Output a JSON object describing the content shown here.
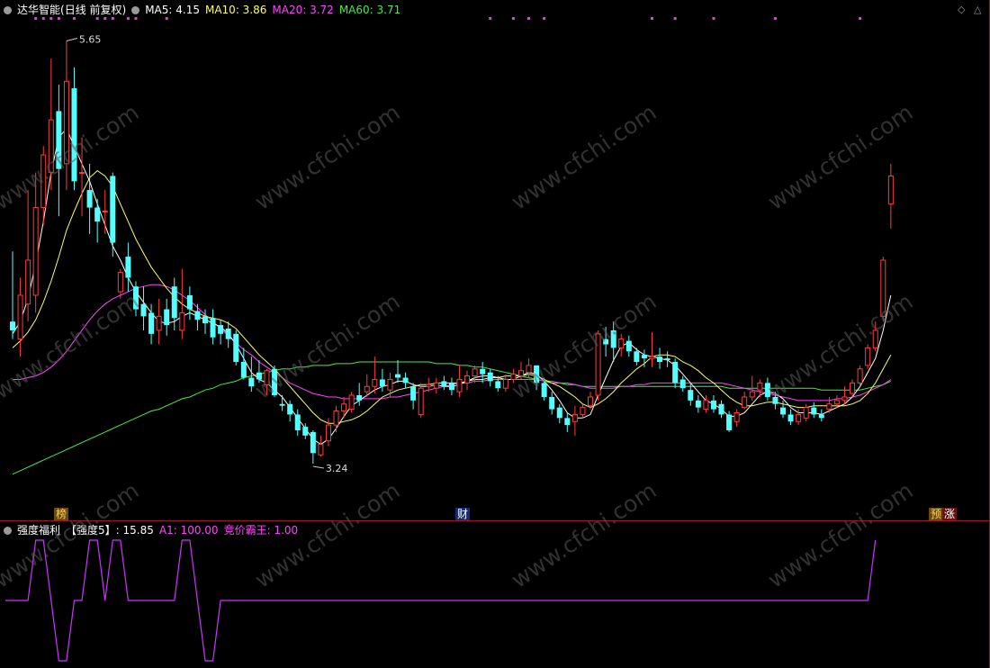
{
  "header": {
    "stock_name": "达华智能",
    "period": "(日线 前复权)",
    "ma_items": [
      {
        "label": "MA5: 4.15",
        "color": "#ffffff"
      },
      {
        "label": "MA10: 3.86",
        "color": "#ffff66"
      },
      {
        "label": "MA20: 3.72",
        "color": "#ff44ff"
      },
      {
        "label": "MA60: 3.71",
        "color": "#44ee44"
      }
    ]
  },
  "indicator_header": {
    "name": "强度福利",
    "items": [
      {
        "label": "【强度5】: 15.85",
        "color": "#ffffff"
      },
      {
        "label": "A1: 100.00",
        "color": "#ff44ff"
      },
      {
        "label": "竞价霸王: 1.00",
        "color": "#ff44ff"
      }
    ]
  },
  "markers": {
    "bang": "榜",
    "cai": "财",
    "yu": "预",
    "zhang": "涨"
  },
  "watermark": "www.cfchi.com",
  "colors": {
    "up": "#ff3c3c",
    "down": "#54ffff",
    "ma5": "#ffffff",
    "ma10": "#ffff66",
    "ma20": "#ff44ff",
    "ma60": "#44ee44",
    "ind": "#cc33ff"
  },
  "chart_data": {
    "type": "candlestick",
    "ylim": [
      3.05,
      5.75
    ],
    "high_label": "5.65",
    "low_label": "3.24",
    "candles": [
      [
        4.05,
        4.0,
        4.45,
        3.95
      ],
      [
        3.95,
        4.2,
        4.3,
        3.85
      ],
      [
        4.15,
        4.4,
        4.8,
        4.05
      ],
      [
        4.2,
        4.7,
        4.9,
        4.1
      ],
      [
        4.7,
        5.0,
        5.05,
        4.6
      ],
      [
        4.9,
        5.2,
        5.55,
        4.8
      ],
      [
        5.25,
        4.92,
        5.4,
        4.65
      ],
      [
        4.95,
        5.42,
        5.65,
        4.8
      ],
      [
        5.38,
        4.85,
        5.5,
        4.8
      ],
      [
        4.9,
        4.9,
        5.1,
        4.65
      ],
      [
        4.8,
        4.7,
        4.95,
        4.55
      ],
      [
        4.7,
        4.62,
        4.75,
        4.5
      ],
      [
        4.68,
        4.68,
        4.8,
        4.55
      ],
      [
        4.88,
        4.5,
        4.9,
        4.42
      ],
      [
        4.22,
        4.33,
        4.35,
        4.18
      ],
      [
        4.42,
        4.3,
        4.5,
        4.22
      ],
      [
        4.25,
        4.12,
        4.28,
        4.08
      ],
      [
        4.15,
        4.08,
        4.25,
        4.0
      ],
      [
        4.1,
        3.98,
        4.15,
        3.92
      ],
      [
        4.0,
        4.08,
        4.18,
        3.92
      ],
      [
        4.12,
        4.03,
        4.18,
        3.97
      ],
      [
        4.25,
        4.07,
        4.3,
        4.0
      ],
      [
        4.0,
        4.1,
        4.35,
        3.95
      ],
      [
        4.2,
        4.12,
        4.25,
        4.06
      ],
      [
        4.11,
        4.06,
        4.15,
        4.0
      ],
      [
        4.08,
        4.04,
        4.12,
        3.98
      ],
      [
        4.07,
        3.96,
        4.12,
        3.92
      ],
      [
        4.03,
        3.98,
        4.06,
        3.92
      ],
      [
        4.01,
        3.95,
        4.05,
        3.9
      ],
      [
        3.98,
        3.82,
        4.0,
        3.8
      ],
      [
        3.82,
        3.73,
        3.9,
        3.72
      ],
      [
        3.73,
        3.68,
        3.85,
        3.65
      ],
      [
        3.76,
        3.72,
        3.83,
        3.7
      ],
      [
        3.69,
        3.77,
        3.78,
        3.63
      ],
      [
        3.78,
        3.63,
        3.8,
        3.62
      ],
      [
        3.58,
        3.57,
        3.63,
        3.54
      ],
      [
        3.58,
        3.52,
        3.6,
        3.48
      ],
      [
        3.52,
        3.43,
        3.55,
        3.4
      ],
      [
        3.45,
        3.4,
        3.47,
        3.38
      ],
      [
        3.42,
        3.3,
        3.43,
        3.24
      ],
      [
        3.29,
        3.35,
        3.4,
        3.28
      ],
      [
        3.37,
        3.46,
        3.5,
        3.34
      ],
      [
        3.46,
        3.54,
        3.57,
        3.42
      ],
      [
        3.54,
        3.58,
        3.62,
        3.5
      ],
      [
        3.55,
        3.63,
        3.65,
        3.53
      ],
      [
        3.63,
        3.6,
        3.7,
        3.57
      ],
      [
        3.65,
        3.68,
        3.75,
        3.62
      ],
      [
        3.68,
        3.72,
        3.85,
        3.64
      ],
      [
        3.72,
        3.68,
        3.78,
        3.65
      ],
      [
        3.66,
        3.72,
        3.76,
        3.62
      ],
      [
        3.75,
        3.73,
        3.83,
        3.7
      ],
      [
        3.73,
        3.7,
        3.76,
        3.67
      ],
      [
        3.68,
        3.6,
        3.7,
        3.55
      ],
      [
        3.52,
        3.67,
        3.7,
        3.5
      ],
      [
        3.68,
        3.69,
        3.73,
        3.65
      ],
      [
        3.67,
        3.7,
        3.73,
        3.64
      ],
      [
        3.71,
        3.68,
        3.74,
        3.66
      ],
      [
        3.7,
        3.66,
        3.73,
        3.63
      ],
      [
        3.65,
        3.72,
        3.8,
        3.62
      ],
      [
        3.7,
        3.74,
        3.77,
        3.66
      ],
      [
        3.74,
        3.78,
        3.8,
        3.7
      ],
      [
        3.78,
        3.75,
        3.82,
        3.7
      ],
      [
        3.76,
        3.71,
        3.78,
        3.68
      ],
      [
        3.71,
        3.67,
        3.74,
        3.65
      ],
      [
        3.67,
        3.72,
        3.75,
        3.65
      ],
      [
        3.72,
        3.75,
        3.78,
        3.7
      ],
      [
        3.74,
        3.77,
        3.82,
        3.72
      ],
      [
        3.76,
        3.8,
        3.84,
        3.73
      ],
      [
        3.8,
        3.7,
        3.8,
        3.66
      ],
      [
        3.7,
        3.62,
        3.73,
        3.6
      ],
      [
        3.62,
        3.55,
        3.65,
        3.52
      ],
      [
        3.56,
        3.5,
        3.58,
        3.47
      ],
      [
        3.5,
        3.46,
        3.53,
        3.42
      ],
      [
        3.48,
        3.52,
        3.57,
        3.4
      ],
      [
        3.52,
        3.56,
        3.58,
        3.5
      ],
      [
        3.57,
        3.62,
        3.65,
        3.55
      ],
      [
        3.63,
        3.98,
        4.0,
        3.6
      ],
      [
        3.95,
        3.92,
        4.02,
        3.85
      ],
      [
        4.0,
        3.9,
        4.05,
        3.82
      ],
      [
        3.9,
        3.95,
        3.98,
        3.85
      ],
      [
        3.94,
        3.88,
        3.97,
        3.85
      ],
      [
        3.88,
        3.82,
        3.9,
        3.8
      ],
      [
        3.86,
        3.84,
        3.89,
        3.79
      ],
      [
        3.84,
        3.85,
        3.99,
        3.79
      ],
      [
        3.85,
        3.82,
        3.9,
        3.78
      ],
      [
        3.84,
        3.83,
        3.88,
        3.79
      ],
      [
        3.82,
        3.7,
        3.84,
        3.67
      ],
      [
        3.72,
        3.67,
        3.74,
        3.65
      ],
      [
        3.66,
        3.6,
        3.7,
        3.57
      ],
      [
        3.6,
        3.56,
        3.63,
        3.53
      ],
      [
        3.55,
        3.6,
        3.63,
        3.53
      ],
      [
        3.6,
        3.55,
        3.63,
        3.53
      ],
      [
        3.58,
        3.52,
        3.6,
        3.5
      ],
      [
        3.52,
        3.43,
        3.54,
        3.42
      ],
      [
        3.48,
        3.53,
        3.55,
        3.45
      ],
      [
        3.56,
        3.62,
        3.65,
        3.55
      ],
      [
        3.62,
        3.65,
        3.74,
        3.6
      ],
      [
        3.66,
        3.7,
        3.72,
        3.62
      ],
      [
        3.7,
        3.62,
        3.73,
        3.6
      ],
      [
        3.62,
        3.58,
        3.65,
        3.55
      ],
      [
        3.56,
        3.52,
        3.6,
        3.5
      ],
      [
        3.52,
        3.48,
        3.55,
        3.46
      ],
      [
        3.48,
        3.52,
        3.55,
        3.46
      ],
      [
        3.5,
        3.56,
        3.58,
        3.48
      ],
      [
        3.56,
        3.52,
        3.59,
        3.5
      ],
      [
        3.52,
        3.5,
        3.55,
        3.48
      ],
      [
        3.55,
        3.58,
        3.62,
        3.53
      ],
      [
        3.58,
        3.6,
        3.63,
        3.56
      ],
      [
        3.6,
        3.62,
        3.68,
        3.58
      ],
      [
        3.64,
        3.7,
        3.72,
        3.62
      ],
      [
        3.7,
        3.78,
        3.8,
        3.68
      ],
      [
        3.8,
        3.9,
        3.92,
        3.78
      ],
      [
        3.9,
        4.0,
        4.05,
        3.88
      ],
      [
        4.08,
        4.4,
        4.42,
        4.05
      ],
      [
        4.72,
        4.88,
        4.95,
        4.58
      ]
    ],
    "ma5": [
      3.98,
      4.05,
      4.18,
      4.38,
      4.62,
      4.9,
      5.1,
      5.15,
      5.05,
      4.95,
      4.85,
      4.72,
      4.6,
      4.48,
      4.4,
      4.3,
      4.22,
      4.16,
      4.1,
      4.05,
      4.04,
      4.05,
      4.08,
      4.1,
      4.08,
      4.06,
      4.04,
      4.02,
      3.98,
      3.92,
      3.84,
      3.76,
      3.72,
      3.7,
      3.66,
      3.62,
      3.56,
      3.5,
      3.44,
      3.38,
      3.35,
      3.38,
      3.44,
      3.51,
      3.57,
      3.6,
      3.63,
      3.66,
      3.68,
      3.69,
      3.71,
      3.71,
      3.69,
      3.68,
      3.68,
      3.69,
      3.68,
      3.68,
      3.69,
      3.71,
      3.73,
      3.74,
      3.74,
      3.73,
      3.72,
      3.72,
      3.74,
      3.76,
      3.75,
      3.71,
      3.66,
      3.6,
      3.53,
      3.5,
      3.5,
      3.52,
      3.63,
      3.73,
      3.83,
      3.91,
      3.93,
      3.89,
      3.86,
      3.85,
      3.84,
      3.83,
      3.8,
      3.75,
      3.7,
      3.65,
      3.6,
      3.58,
      3.55,
      3.51,
      3.51,
      3.53,
      3.58,
      3.63,
      3.65,
      3.64,
      3.61,
      3.56,
      3.53,
      3.53,
      3.53,
      3.52,
      3.54,
      3.56,
      3.58,
      3.62,
      3.68,
      3.76,
      3.84,
      4.0,
      4.2
    ],
    "ma10": [
      3.9,
      3.94,
      3.99,
      4.06,
      4.16,
      4.28,
      4.42,
      4.57,
      4.68,
      4.78,
      4.87,
      4.91,
      4.88,
      4.82,
      4.72,
      4.62,
      4.52,
      4.44,
      4.36,
      4.3,
      4.24,
      4.19,
      4.15,
      4.12,
      4.1,
      4.08,
      4.07,
      4.06,
      4.04,
      4.01,
      3.96,
      3.91,
      3.86,
      3.82,
      3.78,
      3.73,
      3.68,
      3.63,
      3.58,
      3.53,
      3.49,
      3.47,
      3.47,
      3.48,
      3.49,
      3.51,
      3.54,
      3.58,
      3.62,
      3.64,
      3.66,
      3.67,
      3.68,
      3.69,
      3.69,
      3.7,
      3.7,
      3.7,
      3.7,
      3.71,
      3.72,
      3.72,
      3.73,
      3.73,
      3.74,
      3.74,
      3.74,
      3.75,
      3.74,
      3.72,
      3.7,
      3.68,
      3.65,
      3.62,
      3.58,
      3.56,
      3.58,
      3.61,
      3.65,
      3.7,
      3.74,
      3.78,
      3.81,
      3.85,
      3.86,
      3.86,
      3.85,
      3.82,
      3.8,
      3.77,
      3.73,
      3.7,
      3.66,
      3.62,
      3.59,
      3.57,
      3.57,
      3.58,
      3.59,
      3.59,
      3.58,
      3.57,
      3.56,
      3.56,
      3.57,
      3.57,
      3.57,
      3.57,
      3.57,
      3.58,
      3.6,
      3.64,
      3.7,
      3.78,
      3.86
    ],
    "ma20": [
      3.72,
      3.72,
      3.73,
      3.74,
      3.76,
      3.79,
      3.83,
      3.88,
      3.94,
      4.0,
      4.06,
      4.11,
      4.15,
      4.18,
      4.2,
      4.22,
      4.24,
      4.25,
      4.26,
      4.26,
      4.25,
      4.23,
      4.2,
      4.17,
      4.13,
      4.09,
      4.05,
      4.01,
      3.97,
      3.93,
      3.89,
      3.86,
      3.82,
      3.79,
      3.76,
      3.73,
      3.7,
      3.68,
      3.66,
      3.64,
      3.63,
      3.62,
      3.62,
      3.61,
      3.61,
      3.61,
      3.61,
      3.61,
      3.61,
      3.62,
      3.62,
      3.63,
      3.64,
      3.65,
      3.66,
      3.67,
      3.68,
      3.69,
      3.7,
      3.7,
      3.71,
      3.71,
      3.72,
      3.72,
      3.72,
      3.72,
      3.72,
      3.72,
      3.72,
      3.71,
      3.71,
      3.7,
      3.7,
      3.69,
      3.68,
      3.67,
      3.67,
      3.67,
      3.67,
      3.68,
      3.68,
      3.69,
      3.69,
      3.7,
      3.7,
      3.7,
      3.7,
      3.7,
      3.7,
      3.7,
      3.7,
      3.7,
      3.7,
      3.69,
      3.68,
      3.67,
      3.66,
      3.65,
      3.64,
      3.63,
      3.62,
      3.61,
      3.6,
      3.6,
      3.6,
      3.6,
      3.6,
      3.61,
      3.61,
      3.62,
      3.63,
      3.65,
      3.67,
      3.69,
      3.72
    ],
    "ma60": [
      3.18,
      3.2,
      3.22,
      3.24,
      3.26,
      3.28,
      3.3,
      3.32,
      3.34,
      3.36,
      3.38,
      3.4,
      3.42,
      3.44,
      3.46,
      3.48,
      3.5,
      3.52,
      3.54,
      3.55,
      3.57,
      3.59,
      3.61,
      3.62,
      3.64,
      3.66,
      3.67,
      3.69,
      3.7,
      3.71,
      3.73,
      3.74,
      3.75,
      3.76,
      3.77,
      3.78,
      3.78,
      3.79,
      3.79,
      3.8,
      3.8,
      3.8,
      3.81,
      3.81,
      3.81,
      3.82,
      3.82,
      3.82,
      3.82,
      3.82,
      3.82,
      3.82,
      3.82,
      3.82,
      3.82,
      3.81,
      3.81,
      3.81,
      3.8,
      3.8,
      3.79,
      3.79,
      3.78,
      3.77,
      3.76,
      3.75,
      3.74,
      3.73,
      3.72,
      3.71,
      3.7,
      3.7,
      3.69,
      3.69,
      3.68,
      3.68,
      3.68,
      3.68,
      3.68,
      3.68,
      3.68,
      3.68,
      3.68,
      3.68,
      3.68,
      3.68,
      3.68,
      3.68,
      3.68,
      3.68,
      3.68,
      3.68,
      3.68,
      3.67,
      3.67,
      3.67,
      3.67,
      3.67,
      3.67,
      3.67,
      3.67,
      3.67,
      3.67,
      3.67,
      3.67,
      3.66,
      3.66,
      3.66,
      3.66,
      3.66,
      3.66,
      3.67,
      3.68,
      3.69,
      3.71
    ],
    "indicator": [
      0,
      0,
      0,
      100,
      100,
      0,
      -100,
      -100,
      0,
      0,
      100,
      100,
      0,
      100,
      100,
      0,
      0,
      0,
      0,
      0,
      0,
      0,
      100,
      100,
      0,
      -100,
      -100,
      0,
      0,
      0,
      0,
      0,
      0,
      0,
      0,
      0,
      0,
      0,
      0,
      0,
      0,
      0,
      0,
      0,
      0,
      0,
      0,
      0,
      0,
      0,
      0,
      0,
      0,
      0,
      0,
      0,
      0,
      0,
      0,
      0,
      0,
      0,
      0,
      0,
      0,
      0,
      0,
      0,
      0,
      0,
      0,
      0,
      0,
      0,
      0,
      0,
      0,
      0,
      0,
      0,
      0,
      0,
      0,
      0,
      0,
      0,
      0,
      0,
      0,
      0,
      0,
      0,
      0,
      0,
      0,
      0,
      0,
      0,
      0,
      0,
      0,
      0,
      0,
      0,
      0,
      0,
      0,
      0,
      0,
      0,
      0,
      0,
      100
    ],
    "signal_dots": [
      3,
      4,
      5,
      6,
      8,
      11,
      12,
      13,
      15,
      16,
      20,
      62,
      65,
      67,
      69,
      83,
      86,
      91,
      99,
      110
    ]
  }
}
